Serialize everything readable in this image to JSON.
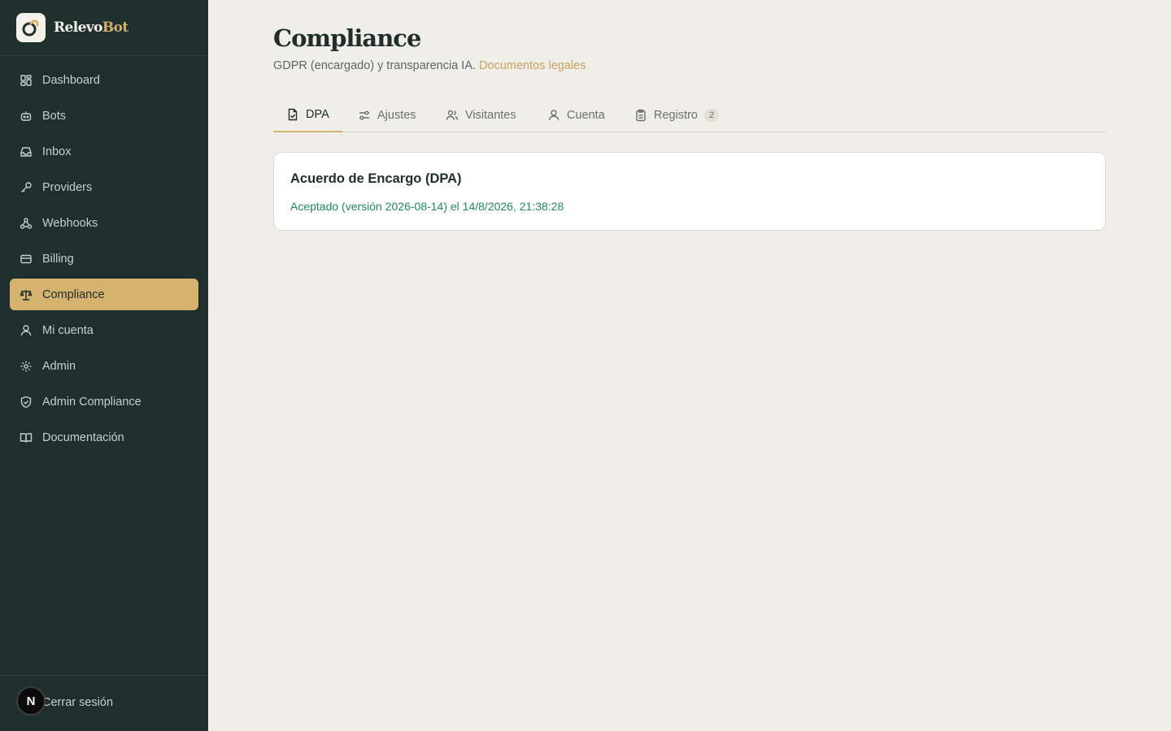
{
  "brand": {
    "name_part1": "Relevo",
    "name_part2": "Bot"
  },
  "sidebar": {
    "items": [
      {
        "label": "Dashboard",
        "icon": "dashboard-icon"
      },
      {
        "label": "Bots",
        "icon": "bot-icon"
      },
      {
        "label": "Inbox",
        "icon": "inbox-icon"
      },
      {
        "label": "Providers",
        "icon": "key-icon"
      },
      {
        "label": "Webhooks",
        "icon": "webhook-icon"
      },
      {
        "label": "Billing",
        "icon": "credit-card-icon"
      },
      {
        "label": "Compliance",
        "icon": "scale-icon",
        "active": true
      },
      {
        "label": "Mi cuenta",
        "icon": "user-icon"
      },
      {
        "label": "Admin",
        "icon": "gear-icon"
      },
      {
        "label": "Admin Compliance",
        "icon": "shield-icon"
      },
      {
        "label": "Documentación",
        "icon": "book-icon"
      }
    ],
    "logout_label": "Cerrar sesión",
    "avatar_letter": "N"
  },
  "page": {
    "title": "Compliance",
    "subtitle": "GDPR (encargado) y transparencia IA.",
    "subtitle_link": "Documentos legales"
  },
  "tabs": [
    {
      "label": "DPA",
      "icon": "file-check-icon",
      "active": true
    },
    {
      "label": "Ajustes",
      "icon": "sliders-icon"
    },
    {
      "label": "Visitantes",
      "icon": "users-icon"
    },
    {
      "label": "Cuenta",
      "icon": "user-icon"
    },
    {
      "label": "Registro",
      "icon": "clipboard-icon",
      "badge": "2"
    }
  ],
  "card": {
    "title": "Acuerdo de Encargo (DPA)",
    "status": "Aceptado (versión 2026-08-14) el 14/8/2026, 21:38:28"
  },
  "colors": {
    "sidebar_bg": "#1e2f2d",
    "accent": "#d5b36f",
    "page_bg": "#f0eee9",
    "success": "#1f8a5f",
    "link": "#c9a060"
  }
}
